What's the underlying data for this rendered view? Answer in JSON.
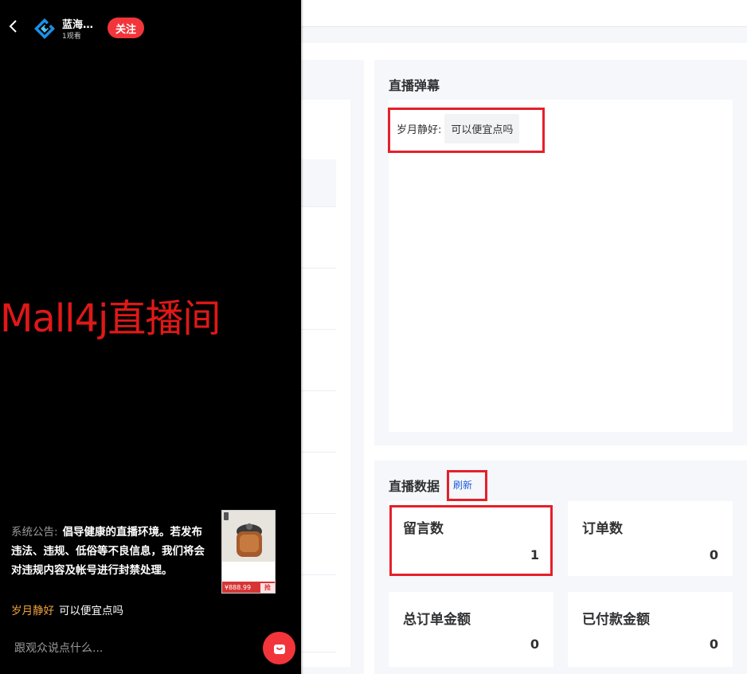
{
  "phone": {
    "anchor_name": "蓝海…",
    "viewer_count": "1观看",
    "follow_label": "关注",
    "room_title": "Mall4j直播间",
    "notice_label": "系统公告:",
    "notice_text": "倡导健康的直播环境。若发布违法、违规、低俗等不良信息，我们将会对违规内容及帐号进行封禁处理。",
    "chat": [
      {
        "user": "岁月静好",
        "message": "可以便宜点吗"
      }
    ],
    "input_placeholder": "跟观众说点什么...",
    "product": {
      "tag": "",
      "desc": "",
      "price": "¥888.99",
      "buy_label": "抢"
    },
    "icons": {
      "back": "chevron-left-icon",
      "logo": "brand-logo-icon",
      "cart": "shopping-bag-icon"
    }
  },
  "danmu": {
    "title": "直播弹幕",
    "items": [
      {
        "user": "岁月静好:",
        "message": "可以便宜点吗"
      }
    ]
  },
  "stats": {
    "title": "直播数据",
    "refresh_label": "刷新",
    "cards": [
      {
        "label": "留言数",
        "value": "1"
      },
      {
        "label": "订单数",
        "value": "0"
      },
      {
        "label": "总订单金额",
        "value": "0"
      },
      {
        "label": "已付款金额",
        "value": "0"
      }
    ]
  },
  "colors": {
    "accent_red": "#f2353b",
    "highlight_border": "#e5202a",
    "link_blue": "#1e5bd8",
    "chat_user": "#f0a23c",
    "room_title": "#e01818"
  }
}
